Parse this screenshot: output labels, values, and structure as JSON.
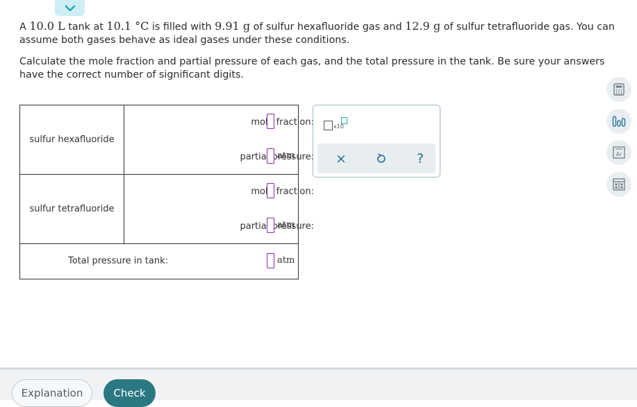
{
  "prompt": {
    "p1_pre_vol": "A ",
    "volume": "10.0 L",
    "p1_pre_temp": " tank at ",
    "temperature": "10.1 °C",
    "p1_pre_mass1": " is filled with ",
    "mass1": "9.91 g",
    "p1_pre_mass2": " of sulfur hexafluoride gas and ",
    "mass2": "12.9 g",
    "p1_end": " of sulfur tetrafluoride gas. You can assume both gases behave as ideal gases under these conditions.",
    "p2": "Calculate the mole fraction and partial pressure of each gas, and the total pressure in the tank. Be sure your answers have the correct number of significant digits."
  },
  "table": {
    "rows": [
      {
        "gas": "sulfur hexafluoride",
        "mole_fraction_label": "mole fraction:",
        "partial_pressure_label": "partial pressure:",
        "unit": "atm"
      },
      {
        "gas": "sulfur tetrafluoride",
        "mole_fraction_label": "mole fraction:",
        "partial_pressure_label": "partial pressure:",
        "unit": "atm"
      }
    ],
    "total_label": "Total pressure in tank:",
    "total_unit": "atm"
  },
  "toolpanel": {
    "x10_label": "x10",
    "clear_symbol": "×",
    "help_symbol": "?"
  },
  "footer": {
    "explanation_label": "Explanation",
    "check_label": "Check"
  },
  "colors": {
    "accent": "#1fa7b5",
    "check_button": "#2a7882",
    "input_border": "#8a2aa8"
  }
}
